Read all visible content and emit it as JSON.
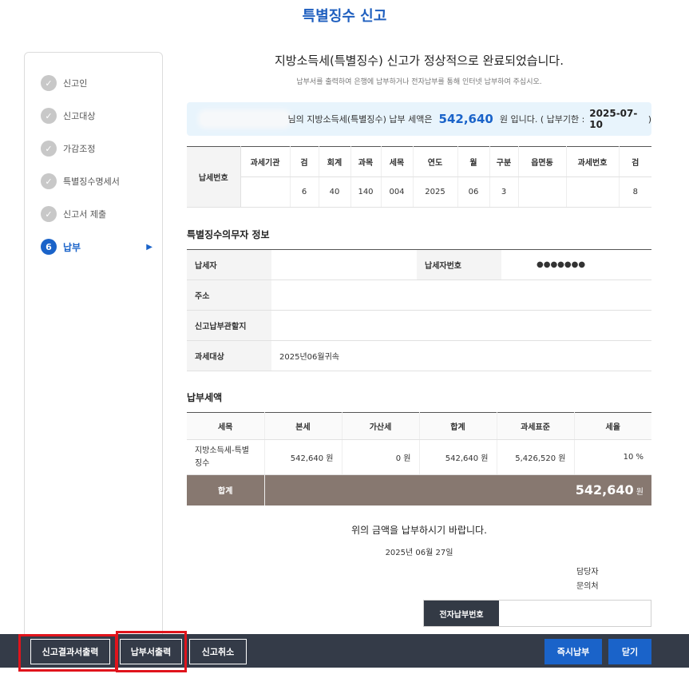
{
  "page": {
    "title": "특별징수 신고"
  },
  "sidebar": {
    "steps": [
      {
        "label": "신고인"
      },
      {
        "label": "신고대상"
      },
      {
        "label": "가감조정"
      },
      {
        "label": "특별징수명세서"
      },
      {
        "label": "신고서 제출"
      },
      {
        "label": "납부",
        "number": "6"
      }
    ],
    "done_icon": "check-icon",
    "active_icon": "triangle-right-icon"
  },
  "main": {
    "done_message": "지방소득세(특별징수) 신고가 정상적으로 완료되었습니다.",
    "sub_message": "납부서를 출력하여 은행에 납부하거나 전자납부를 통해 인터넷 납부하여 주십시오.",
    "info_box": {
      "text_before": "님의 지방소득세(특별징수) 납부 세액은",
      "amount": "542,640",
      "text_after": "원 입니다. ( 납부기한 :",
      "due_date": "2025-07-10",
      "close_paren": ")"
    }
  },
  "payment_number": {
    "row_header": "납세번호",
    "headers": [
      "과세기관",
      "검",
      "회계",
      "과목",
      "세목",
      "연도",
      "월",
      "구분",
      "읍면동",
      "과세번호",
      "검"
    ],
    "values": [
      "",
      "6",
      "40",
      "140",
      "004",
      "2025",
      "06",
      "3",
      "",
      "",
      "8"
    ]
  },
  "obligor": {
    "title": "특별징수의무자 정보",
    "rows": {
      "taxpayer_label": "납세자",
      "taxpayer_value": "",
      "taxpayer_no_label": "납세자번호",
      "taxpayer_no_value": "●●●●●●●",
      "address_label": "주소",
      "address_value": "",
      "office_label": "신고납부관할지",
      "office_value": "",
      "target_label": "과세대상",
      "target_value": "2025년06월귀속"
    }
  },
  "tax": {
    "title": "납부세액",
    "headers": [
      "세목",
      "본세",
      "가산세",
      "합계",
      "과세표준",
      "세율"
    ],
    "row": [
      "지방소득세-특별징수",
      "542,640 원",
      "0 원",
      "542,640 원",
      "5,426,520 원",
      "10 %"
    ],
    "sum_label": "합계",
    "sum_amount": "542,640",
    "sum_unit": "원"
  },
  "footer": {
    "please_pay": "위의 금액을 납부하시기 바랍니다.",
    "date": "2025년 06월 27일",
    "manager_label": "담당자",
    "inquiry_label": "문의처",
    "epay_label": "전자납부번호",
    "epay_value": ""
  },
  "bottom_bar": {
    "report_print": "신고결과서출력",
    "bill_print": "납부서출력",
    "cancel": "신고취소",
    "pay_now": "즉시납부",
    "close": "닫기"
  }
}
